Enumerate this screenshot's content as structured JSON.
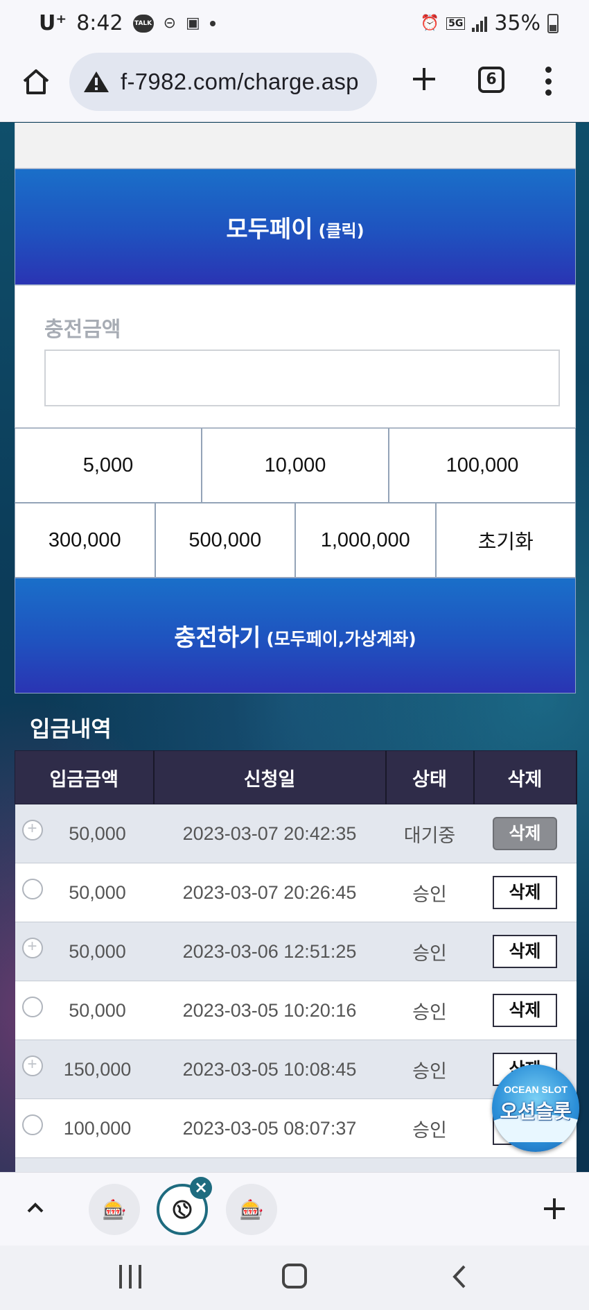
{
  "status_bar": {
    "carrier": "U⁺",
    "time": "8:42",
    "talk_badge": "TALK",
    "network": "5G",
    "battery": "35%"
  },
  "browser": {
    "url": "f-7982.com/charge.asp",
    "tab_count": "6"
  },
  "charge": {
    "modupay_label": "모두페이",
    "modupay_sub": "(클릭)",
    "amount_label": "충전금액",
    "amount_value": "",
    "quick_amounts_row1": [
      "5,000",
      "10,000",
      "100,000"
    ],
    "quick_amounts_row2": [
      "300,000",
      "500,000",
      "1,000,000"
    ],
    "reset_label": "초기화",
    "charge_label": "충전하기",
    "charge_sub": "(모두페이,가상계좌)"
  },
  "history": {
    "title": "입금내역",
    "columns": [
      "입금금액",
      "신청일",
      "상태",
      "삭제"
    ],
    "rows": [
      {
        "amount": "50,000",
        "date": "2023-03-07 20:42:35",
        "status": "대기중",
        "delete": "삭제"
      },
      {
        "amount": "50,000",
        "date": "2023-03-07 20:26:45",
        "status": "승인",
        "delete": "삭제"
      },
      {
        "amount": "50,000",
        "date": "2023-03-06 12:51:25",
        "status": "승인",
        "delete": "삭제"
      },
      {
        "amount": "50,000",
        "date": "2023-03-05 10:20:16",
        "status": "승인",
        "delete": "삭제"
      },
      {
        "amount": "150,000",
        "date": "2023-03-05 10:08:45",
        "status": "승인",
        "delete": "삭제"
      },
      {
        "amount": "100,000",
        "date": "2023-03-05 08:07:37",
        "status": "승인",
        "delete": "삭제"
      }
    ]
  },
  "ocean_badge": {
    "en": "OCEAN SLOT",
    "ko": "오션슬롯"
  },
  "colors": {
    "button_blue": "#1f52bf",
    "table_header": "#2f2c49",
    "tab_accent": "#1e6b7f"
  }
}
